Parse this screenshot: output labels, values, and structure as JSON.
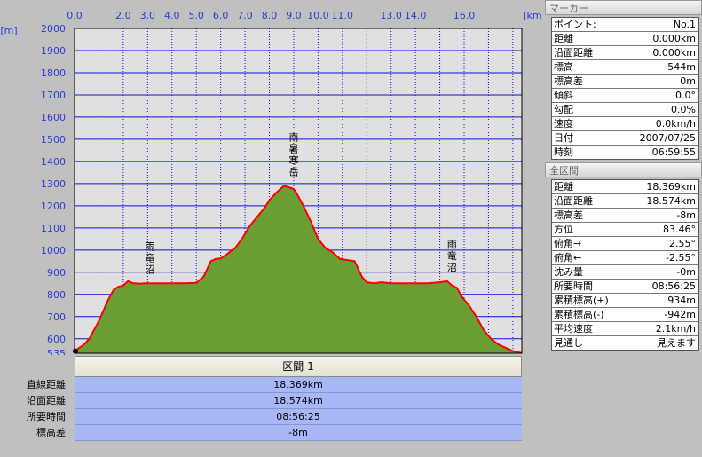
{
  "chart_data": {
    "type": "area",
    "xlabel": "",
    "ylabel": "",
    "x_unit_label": "[km]",
    "y_unit_label": "[m]",
    "xlim": [
      0,
      18.369
    ],
    "ylim": [
      535,
      2000
    ],
    "x_tick_labels": [
      {
        "value": 0.0,
        "label": "0.0"
      },
      {
        "value": 2.0,
        "label": "2.0"
      },
      {
        "value": 3.0,
        "label": "3.0"
      },
      {
        "value": 4.0,
        "label": "4.0"
      },
      {
        "value": 5.0,
        "label": "5.0"
      },
      {
        "value": 6.0,
        "label": "6.0"
      },
      {
        "value": 7.0,
        "label": "7.0"
      },
      {
        "value": 8.0,
        "label": "8.0"
      },
      {
        "value": 9.0,
        "label": "9.0"
      },
      {
        "value": 10.0,
        "label": "10.0"
      },
      {
        "value": 11.0,
        "label": "11.0"
      },
      {
        "value": 13.0,
        "label": "13.0"
      },
      {
        "value": 14.0,
        "label": "14.0"
      },
      {
        "value": 16.0,
        "label": "16.0"
      }
    ],
    "y_tick_labels": [
      {
        "value": 535,
        "label": "535"
      },
      {
        "value": 600,
        "label": "600"
      },
      {
        "value": 700,
        "label": "700"
      },
      {
        "value": 800,
        "label": "800"
      },
      {
        "value": 900,
        "label": "900"
      },
      {
        "value": 1000,
        "label": "1000"
      },
      {
        "value": 1100,
        "label": "1100"
      },
      {
        "value": 1200,
        "label": "1200"
      },
      {
        "value": 1300,
        "label": "1300"
      },
      {
        "value": 1400,
        "label": "1400"
      },
      {
        "value": 1500,
        "label": "1500"
      },
      {
        "value": 1600,
        "label": "1600"
      },
      {
        "value": 1700,
        "label": "1700"
      },
      {
        "value": 1800,
        "label": "1800"
      },
      {
        "value": 1900,
        "label": "1900"
      },
      {
        "value": 2000,
        "label": "2000"
      }
    ],
    "x_gridlines": [
      1,
      2,
      3,
      4,
      5,
      6,
      7,
      8,
      9,
      10,
      11,
      12,
      13,
      14,
      15,
      16,
      17,
      18
    ],
    "y_gridlines": [
      600,
      700,
      800,
      900,
      1000,
      1100,
      1200,
      1300,
      1400,
      1500,
      1600,
      1700,
      1800,
      1900
    ],
    "grid": true,
    "colors": {
      "fill": "#6a9e34",
      "line": "#ff0000",
      "plot_bg": "#e0e0e0",
      "grid": "#1010d0",
      "axis_text": "#2b3bd6"
    },
    "series": [
      {
        "x": [
          0,
          0.2,
          0.4,
          0.6,
          0.8,
          1.0,
          1.2,
          1.4,
          1.6,
          1.8,
          2.0,
          2.2,
          2.4,
          2.5,
          2.7,
          2.9,
          3.0,
          3.5,
          4.0,
          4.5,
          5.0,
          5.3,
          5.6,
          5.8,
          6.0,
          6.3,
          6.6,
          6.9,
          7.2,
          7.5,
          7.8,
          8.0,
          8.3,
          8.6,
          8.9,
          9.0,
          9.1,
          9.4,
          9.7,
          10.0,
          10.3,
          10.6,
          10.9,
          11.2,
          11.5,
          11.8,
          12.0,
          12.3,
          12.6,
          13.0,
          13.5,
          14.0,
          14.5,
          15.0,
          15.3,
          15.5,
          15.7,
          15.9,
          16.2,
          16.5,
          16.8,
          17.1,
          17.4,
          17.7,
          18.0,
          18.369
        ],
        "y": [
          544,
          560,
          575,
          600,
          640,
          680,
          730,
          780,
          820,
          835,
          840,
          860,
          850,
          850,
          848,
          850,
          850,
          850,
          850,
          850,
          852,
          880,
          950,
          960,
          962,
          985,
          1010,
          1055,
          1110,
          1150,
          1190,
          1225,
          1260,
          1290,
          1280,
          1275,
          1260,
          1200,
          1130,
          1050,
          1010,
          990,
          960,
          955,
          950,
          880,
          855,
          850,
          855,
          850,
          850,
          850,
          850,
          855,
          860,
          840,
          830,
          790,
          750,
          700,
          640,
          600,
          575,
          560,
          545,
          536
        ]
      }
    ],
    "annotations": [
      {
        "text": "雨竜沼",
        "x": 3.1,
        "y": 850
      },
      {
        "text": "南暑寒岳",
        "x": 9.0,
        "y": 1290
      },
      {
        "text": "雨竜沼",
        "x": 15.5,
        "y": 860
      }
    ]
  },
  "segment": {
    "header": "区間 1",
    "rows": [
      {
        "label": "直線距離",
        "value": "18.369km"
      },
      {
        "label": "沿面距離",
        "value": "18.574km"
      },
      {
        "label": "所要時間",
        "value": "08:56:25"
      },
      {
        "label": "標高差",
        "value": "-8m"
      }
    ]
  },
  "marker_panel": {
    "title": "マーカー",
    "rows": [
      {
        "label": "ポイント:",
        "value": "No.1"
      },
      {
        "label": "距離",
        "value": "0.000km"
      },
      {
        "label": "沿面距離",
        "value": "0.000km"
      },
      {
        "label": "標高",
        "value": "544m"
      },
      {
        "label": "標高差",
        "value": "0m"
      },
      {
        "label": "傾斜",
        "value": "0.0°"
      },
      {
        "label": "勾配",
        "value": "0.0%"
      },
      {
        "label": "速度",
        "value": "0.0km/h"
      },
      {
        "label": "日付",
        "value": "2007/07/25"
      },
      {
        "label": "時刻",
        "value": "06:59:55"
      }
    ]
  },
  "all_segments_panel": {
    "title": "全区間",
    "rows": [
      {
        "label": "距離",
        "value": "18.369km"
      },
      {
        "label": "沿面距離",
        "value": "18.574km"
      },
      {
        "label": "標高差",
        "value": "-8m"
      },
      {
        "label": "方位",
        "value": "83.46°"
      },
      {
        "label": "俯角→",
        "value": "2.55°"
      },
      {
        "label": "俯角←",
        "value": "-2.55°"
      },
      {
        "label": "沈み量",
        "value": "-0m"
      },
      {
        "label": "所要時間",
        "value": "08:56:25"
      },
      {
        "label": "累積標高(+)",
        "value": "934m"
      },
      {
        "label": "累積標高(-)",
        "value": "-942m"
      },
      {
        "label": "平均速度",
        "value": "2.1km/h"
      },
      {
        "label": "見通し",
        "value": "見えます"
      }
    ]
  }
}
